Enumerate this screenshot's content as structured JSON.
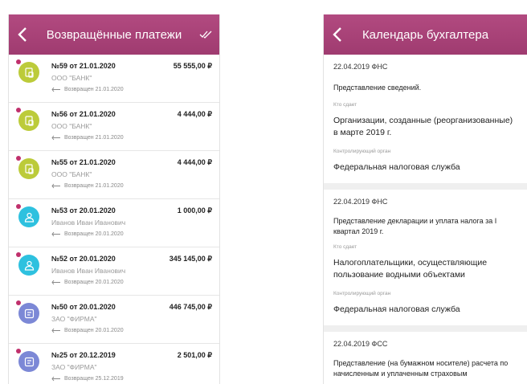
{
  "left": {
    "title": "Возвращённые платежи",
    "payments": [
      {
        "title": "№59 от 21.01.2020",
        "amount": "55 555,00 ₽",
        "sub": "ООО \"БАНК\"",
        "returned": "Возвращен 21.01.2020",
        "icon": "document-icon",
        "color": "#bccb3a"
      },
      {
        "title": "№56 от 21.01.2020",
        "amount": "4 444,00 ₽",
        "sub": "ООО \"БАНК\"",
        "returned": "Возвращен 21.01.2020",
        "icon": "document-icon",
        "color": "#bccb3a"
      },
      {
        "title": "№55 от 21.01.2020",
        "amount": "4 444,00 ₽",
        "sub": "ООО \"БАНК\"",
        "returned": "Возвращен 21.01.2020",
        "icon": "document-icon",
        "color": "#bccb3a"
      },
      {
        "title": "№53 от 20.01.2020",
        "amount": "1 000,00 ₽",
        "sub": "Иванов Иван Иванович",
        "returned": "Возвращен 20.01.2020",
        "icon": "person-icon",
        "color": "#2ec1df"
      },
      {
        "title": "№52 от 20.01.2020",
        "amount": "345 145,00 ₽",
        "sub": "Иванов Иван Иванович",
        "returned": "Возвращен 20.01.2020",
        "icon": "person-icon",
        "color": "#2ec1df"
      },
      {
        "title": "№50 от 20.01.2020",
        "amount": "446 745,00 ₽",
        "sub": "ЗАО \"ФИРМА\"",
        "returned": "Возвращен 20.01.2020",
        "icon": "company-icon",
        "color": "#7c88d6"
      },
      {
        "title": "№25 от 20.12.2019",
        "amount": "2 501,00 ₽",
        "sub": "ЗАО \"ФИРМА\"",
        "returned": "Возвращен 25.12.2019",
        "icon": "company-icon",
        "color": "#7c88d6"
      }
    ]
  },
  "right": {
    "title": "Календарь бухгалтера",
    "events": [
      {
        "header": "22.04.2019 ФНС",
        "description": "Представление сведений.",
        "who_label": "Кто сдает",
        "who": "Организации, созданные (реорганизованные) в марте 2019 г.",
        "authority_label": "Контролирующий орган",
        "authority": "Федеральная налоговая служба"
      },
      {
        "header": "22.04.2019 ФНС",
        "description": "Представление декларации и уплата налога за I квартал 2019 г.",
        "who_label": "Кто сдает",
        "who": "Налогоплательщики, осуществляющие пользование водными объектами",
        "authority_label": "Контролирующий орган",
        "authority": "Федеральная налоговая служба"
      },
      {
        "header": "22.04.2019 ФСС",
        "description": "Представление (на бумажном носителе) расчета по начисленным и уплаченным страховым"
      }
    ]
  }
}
